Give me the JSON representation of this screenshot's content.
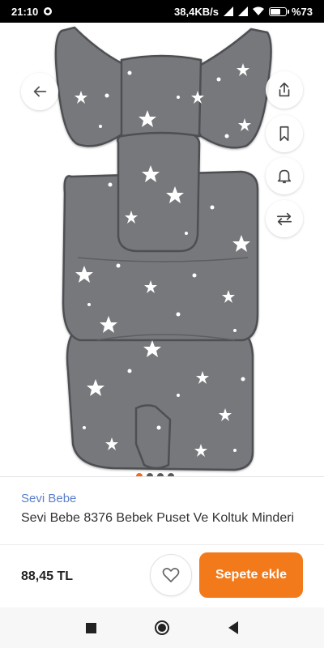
{
  "status_bar": {
    "time": "21:10",
    "network_speed": "38,4KB/s",
    "battery": "%73",
    "battery_level": 0.73
  },
  "gallery": {
    "image_count": 4,
    "active_index": 0
  },
  "actions": {
    "back_icon": "arrow-left-icon",
    "share_icon": "share-icon",
    "bookmark_icon": "bookmark-icon",
    "bell_icon": "bell-icon",
    "compare_icon": "compare-arrows-icon"
  },
  "product": {
    "brand": "Sevi Bebe",
    "title": "Sevi Bebe 8376 Bebek Puset Ve Koltuk Minderi",
    "price": "88,45 TL"
  },
  "buttons": {
    "add_to_cart": "Sepete ekle",
    "favorite_icon": "heart-icon"
  },
  "colors": {
    "accent": "#f27a1a",
    "brand_link": "#5b7fc9",
    "cushion": "#77787c"
  }
}
